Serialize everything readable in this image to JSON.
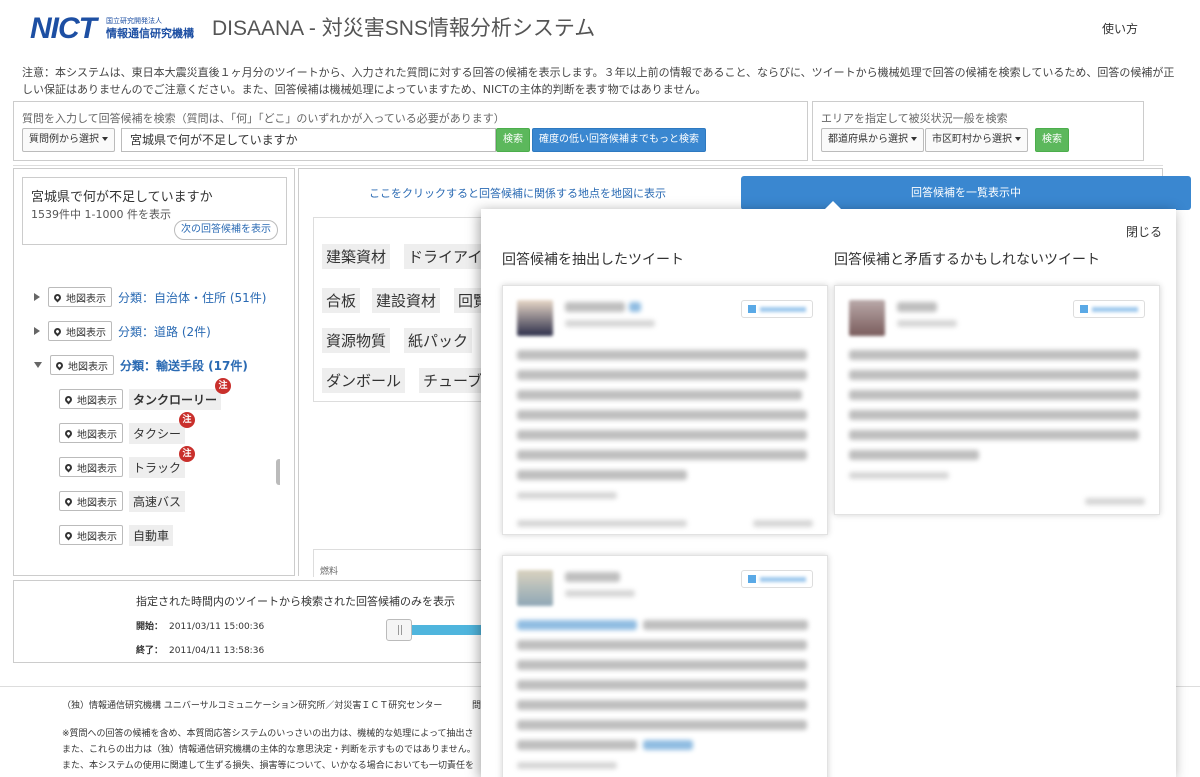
{
  "header": {
    "logo_mark": "NICT",
    "logo_sub": "国立研究開発法人",
    "logo_name": "情報通信研究機構",
    "app_title": "DISAANA - 対災害SNS情報分析システム",
    "help": "使い方"
  },
  "notice": "注意：本システムは、東日本大震災直後１ヶ月分のツイートから、入力された質問に対する回答の候補を表示します。３年以上前の情報であること、ならびに、ツイートから機械処理で回答の候補を検索しているため、回答の候補が正しい保証はありませんのでご注意ください。また、回答候補は機械処理によっていますため、NICTの主体的判断を表す物ではありません。",
  "question_search": {
    "label": "質問を入力して回答候補を検索（質問は、「何」「どこ」のいずれかが入っている必要があります）",
    "example_select": "質問例から選択",
    "input_value": "宮城県で何が不足していますか",
    "search_button": "検索",
    "more_button": "確度の低い回答候補までもっと検索"
  },
  "area_search": {
    "label": "エリアを指定して被災状況一般を検索",
    "prefecture_select": "都道府県から選択",
    "city_select": "市区町村から選択",
    "search_button": "検索"
  },
  "sidebar": {
    "answer_title": "宮城県で何が不足していますか",
    "answer_count": "1539件中 1-1000 件を表示",
    "next_button": "次の回答候補を表示",
    "map_label": "地図表示",
    "categories": [
      {
        "label": "分類：自治体・住所 (51件)"
      },
      {
        "label": "分類：道路 (2件)"
      },
      {
        "label": "分類：輸送手段 (17件)"
      }
    ],
    "items": [
      {
        "term": "タンクローリー",
        "badge": "注"
      },
      {
        "term": "タクシー",
        "badge": "注"
      },
      {
        "term": "トラック",
        "badge": "注"
      },
      {
        "term": "高速バス"
      },
      {
        "term": "自動車"
      }
    ]
  },
  "main": {
    "map_link": "ここをクリックすると回答候補に関係する地点を地図に表示",
    "list_toggle": "回答候補を一覧表示中",
    "words": [
      "建築資材",
      "ドライアイ",
      "合板",
      "建設資材",
      "回覧",
      "資源物質",
      "紙パック",
      "ダンボール",
      "チューブ"
    ],
    "fuel_label": "燃料"
  },
  "time_filter": {
    "title": "指定された時間内のツイートから検索された回答候補のみを表示",
    "start_label": "開始：",
    "start_value": "2011/03/11 15:00:36",
    "end_label": "終了：",
    "end_value": "2011/04/11 13:58:36"
  },
  "footer": {
    "org": "（独）情報通信研究機構 ユニバーサルコミュニケーション研究所／対災害ＩＣＴ研究センター",
    "extra": "問",
    "disclaimer": [
      "※質問への回答の候補を含め、本質問応答システムのいっさいの出力は、機械的な処理によって抽出さ",
      "また、これらの出力は（独）情報通信研究機構の主体的な意思決定・判断を示すものではありません。",
      "また、本システムの使用に関連して生ずる損失、損害等について、いかなる場合においても一切責任を"
    ]
  },
  "popup": {
    "close": "閉じる",
    "left_title": "回答候補を抽出したツイート",
    "right_title": "回答候補と矛盾するかもしれないツイート"
  }
}
